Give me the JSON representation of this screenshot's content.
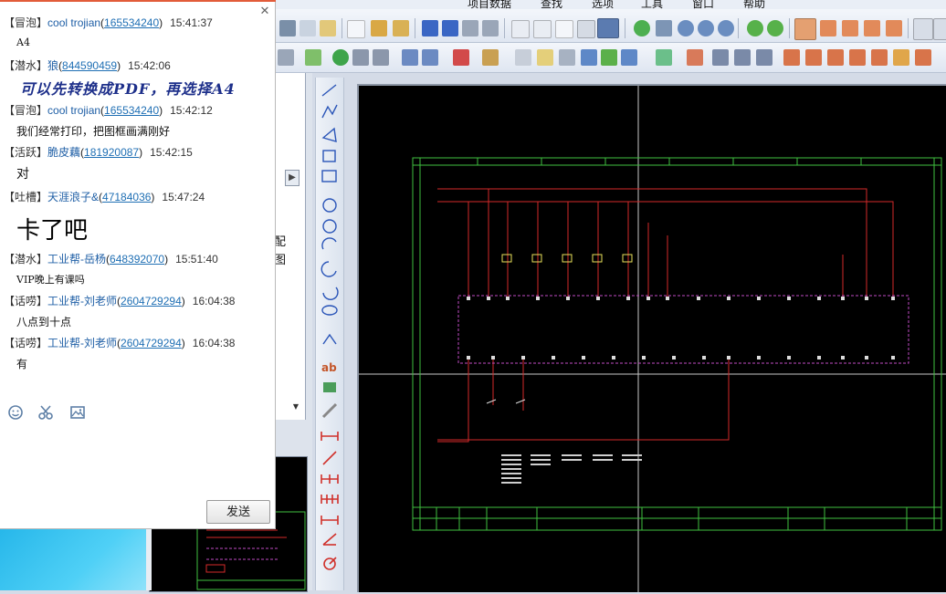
{
  "app": {
    "menus": [
      "项目数据",
      "查找",
      "选项",
      "工具",
      "窗口",
      "帮助"
    ],
    "left_panel_partial_lines": [
      "配",
      "图"
    ]
  },
  "chat": {
    "messages": [
      {
        "rank": "【冒泡】",
        "nick": "cool trojian",
        "uid": "165534240",
        "time": "15:41:37",
        "text": "A4",
        "style": "mono"
      },
      {
        "rank": "【潜水】",
        "nick": "狼",
        "uid": "844590459",
        "time": "15:42:06",
        "text": "可以先转换成PDF，再选择A4",
        "style": "blue-italic"
      },
      {
        "rank": "【冒泡】",
        "nick": "cool trojian",
        "uid": "165534240",
        "time": "15:42:12",
        "text": "我们经常打印，把图框画满刚好",
        "style": "normal"
      },
      {
        "rank": "【活跃】",
        "nick": "脆皮藕",
        "uid": "181920087",
        "time": "15:42:15",
        "text": "对",
        "style": "normal"
      },
      {
        "rank": "【吐槽】",
        "nick": "天涯浪子&",
        "uid": "47184036",
        "time": "15:47:24",
        "text": "卡了吧",
        "style": "big"
      },
      {
        "rank": "【潜水】",
        "nick": "工业帮-岳杨",
        "uid": "648392070",
        "time": "15:51:40",
        "text": "VIP晚上有课吗",
        "style": "mono"
      },
      {
        "rank": "【话唠】",
        "nick": "工业帮-刘老师",
        "uid": "2604729294",
        "time": "16:04:38",
        "text": "八点到十点",
        "style": "normal"
      },
      {
        "rank": "【话唠】",
        "nick": "工业帮-刘老师",
        "uid": "2604729294",
        "time": "16:04:38",
        "text": "有",
        "style": "normal"
      }
    ],
    "send_label": "发送",
    "icons": [
      "emoji-icon",
      "screenshot-icon",
      "image-icon"
    ]
  },
  "colors": {
    "accent": "#e25c3a",
    "link": "#1f6fb4",
    "schematic_border": "#3fbf3f",
    "wire_red": "#d42a2a",
    "terminal_magenta": "#c04bc4"
  }
}
